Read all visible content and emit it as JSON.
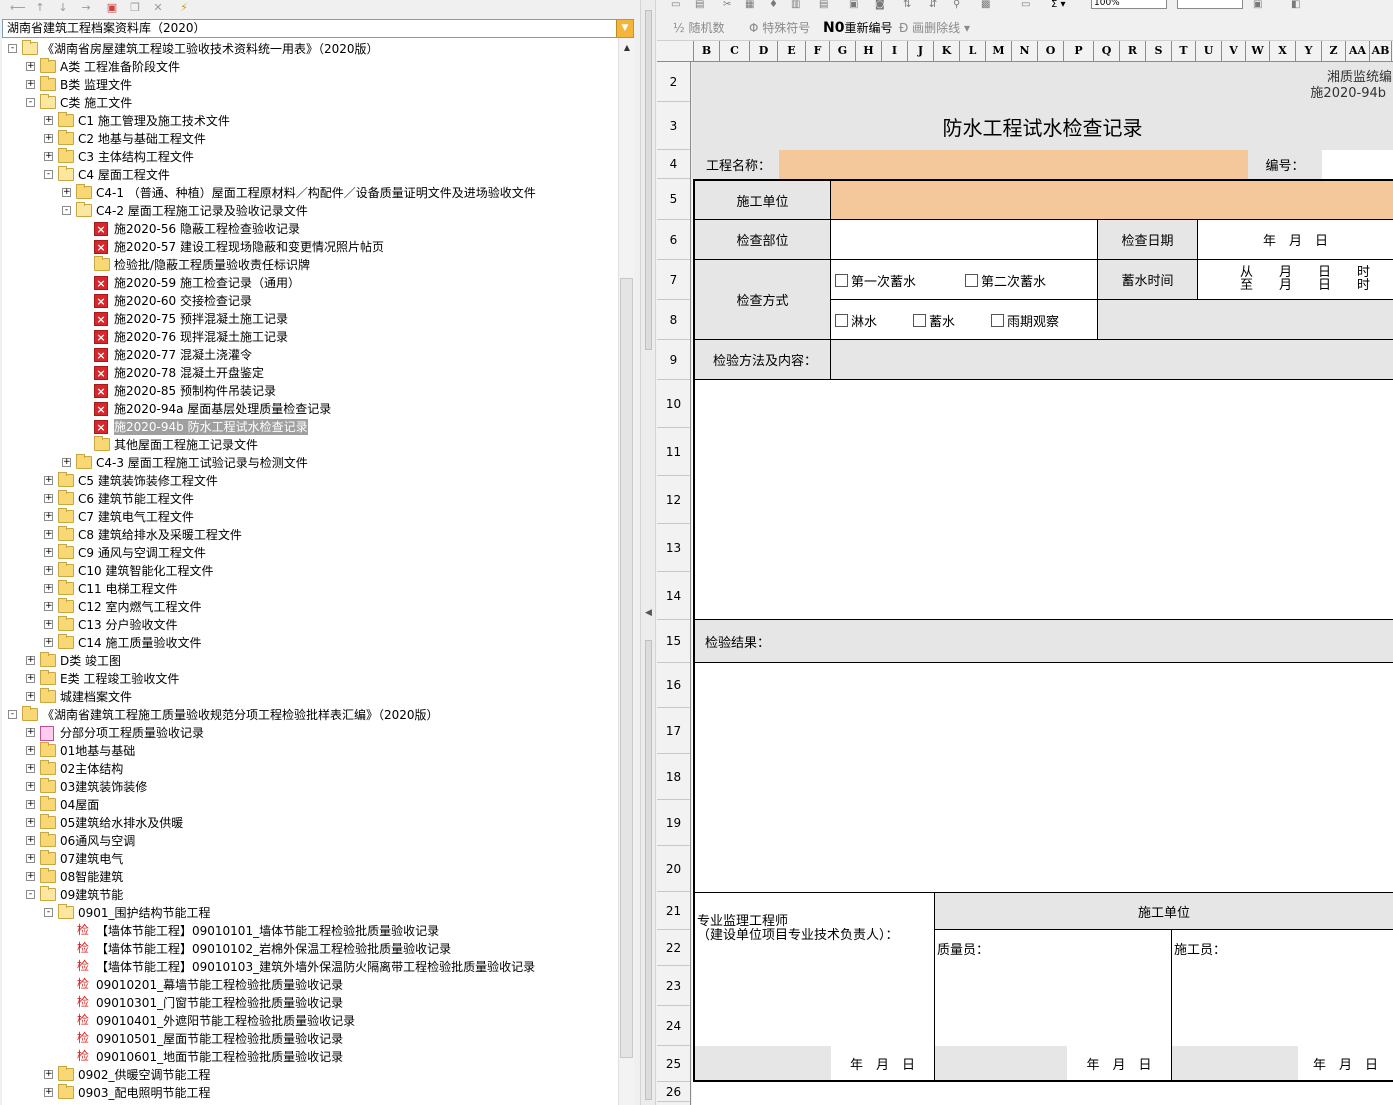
{
  "left_toolbar": {
    "icons": [
      "arrow-left-icon",
      "arrow-up-icon",
      "arrow-down-icon",
      "arrow-right-icon",
      "new-doc-icon",
      "copy-icon",
      "delete-icon",
      "flash-icon"
    ]
  },
  "combo": {
    "value": "湖南省建筑工程档案资料库（2020）"
  },
  "tree": [
    {
      "level": 0,
      "exp": "-",
      "icon": "folder-open",
      "label": "《湖南省房屋建筑工程竣工验收技术资料统一用表》（2020版）"
    },
    {
      "level": 1,
      "exp": "+",
      "icon": "folder",
      "label": "A类 工程准备阶段文件"
    },
    {
      "level": 1,
      "exp": "+",
      "icon": "folder",
      "label": "B类 监理文件"
    },
    {
      "level": 1,
      "exp": "-",
      "icon": "folder-open",
      "label": "C类 施工文件"
    },
    {
      "level": 2,
      "exp": "+",
      "icon": "folder",
      "label": "C1 施工管理及施工技术文件"
    },
    {
      "level": 2,
      "exp": "+",
      "icon": "folder",
      "label": "C2 地基与基础工程文件"
    },
    {
      "level": 2,
      "exp": "+",
      "icon": "folder",
      "label": "C3 主体结构工程文件"
    },
    {
      "level": 2,
      "exp": "-",
      "icon": "folder-open",
      "label": "C4 屋面工程文件"
    },
    {
      "level": 3,
      "exp": "+",
      "icon": "folder",
      "label": "C4-1 （普通、种植）屋面工程原材料／构配件／设备质量证明文件及进场验收文件"
    },
    {
      "level": 3,
      "exp": "-",
      "icon": "folder-open",
      "label": "C4-2 屋面工程施工记录及验收记录文件"
    },
    {
      "level": 4,
      "exp": "",
      "icon": "redx",
      "label": "施2020-56 隐蔽工程检查验收记录"
    },
    {
      "level": 4,
      "exp": "",
      "icon": "redx",
      "label": "施2020-57 建设工程现场隐蔽和变更情况照片帖页"
    },
    {
      "level": 4,
      "exp": "",
      "icon": "folder",
      "label": "检验批/隐蔽工程质量验收责任标识牌"
    },
    {
      "level": 4,
      "exp": "",
      "icon": "redx",
      "label": "施2020-59 施工检查记录（通用）"
    },
    {
      "level": 4,
      "exp": "",
      "icon": "redx",
      "label": "施2020-60 交接检查记录"
    },
    {
      "level": 4,
      "exp": "",
      "icon": "redx",
      "label": "施2020-75 预拌混凝土施工记录"
    },
    {
      "level": 4,
      "exp": "",
      "icon": "redx",
      "label": "施2020-76 现拌混凝土施工记录"
    },
    {
      "level": 4,
      "exp": "",
      "icon": "redx",
      "label": "施2020-77 混凝土浇灌令"
    },
    {
      "level": 4,
      "exp": "",
      "icon": "redx",
      "label": "施2020-78 混凝土开盘鉴定"
    },
    {
      "level": 4,
      "exp": "",
      "icon": "redx",
      "label": "施2020-85 预制构件吊装记录"
    },
    {
      "level": 4,
      "exp": "",
      "icon": "redx",
      "label": "施2020-94a 屋面基层处理质量检查记录"
    },
    {
      "level": 4,
      "exp": "",
      "icon": "redx",
      "label": "施2020-94b 防水工程试水检查记录",
      "selected": true
    },
    {
      "level": 4,
      "exp": "",
      "icon": "folder",
      "label": "其他屋面工程施工记录文件"
    },
    {
      "level": 3,
      "exp": "+",
      "icon": "folder",
      "label": "C4-3 屋面工程施工试验记录与检测文件"
    },
    {
      "level": 2,
      "exp": "+",
      "icon": "folder",
      "label": "C5 建筑装饰装修工程文件"
    },
    {
      "level": 2,
      "exp": "+",
      "icon": "folder",
      "label": "C6 建筑节能工程文件"
    },
    {
      "level": 2,
      "exp": "+",
      "icon": "folder",
      "label": "C7 建筑电气工程文件"
    },
    {
      "level": 2,
      "exp": "+",
      "icon": "folder",
      "label": "C8 建筑给排水及采暖工程文件"
    },
    {
      "level": 2,
      "exp": "+",
      "icon": "folder",
      "label": "C9 通风与空调工程文件"
    },
    {
      "level": 2,
      "exp": "+",
      "icon": "folder",
      "label": "C10 建筑智能化工程文件"
    },
    {
      "level": 2,
      "exp": "+",
      "icon": "folder",
      "label": "C11 电梯工程文件"
    },
    {
      "level": 2,
      "exp": "+",
      "icon": "folder",
      "label": "C12 室内燃气工程文件"
    },
    {
      "level": 2,
      "exp": "+",
      "icon": "folder",
      "label": "C13 分户验收文件"
    },
    {
      "level": 2,
      "exp": "+",
      "icon": "folder",
      "label": "C14 施工质量验收文件"
    },
    {
      "level": 1,
      "exp": "+",
      "icon": "folder",
      "label": "D类 竣工图"
    },
    {
      "level": 1,
      "exp": "+",
      "icon": "folder",
      "label": "E类 工程竣工验收文件"
    },
    {
      "level": 1,
      "exp": "+",
      "icon": "folder",
      "label": "城建档案文件"
    },
    {
      "level": 0,
      "exp": "-",
      "icon": "folder",
      "label": "《湖南省建筑工程施工质量验收规范分项工程检验批样表汇编》（2020版）"
    },
    {
      "level": 1,
      "exp": "+",
      "icon": "doc",
      "label": "分部分项工程质量验收记录"
    },
    {
      "level": 1,
      "exp": "+",
      "icon": "folder",
      "label": "01地基与基础"
    },
    {
      "level": 1,
      "exp": "+",
      "icon": "folder",
      "label": "02主体结构"
    },
    {
      "level": 1,
      "exp": "+",
      "icon": "folder",
      "label": "03建筑装饰装修"
    },
    {
      "level": 1,
      "exp": "+",
      "icon": "folder",
      "label": "04屋面"
    },
    {
      "level": 1,
      "exp": "+",
      "icon": "folder",
      "label": "05建筑给水排水及供暖"
    },
    {
      "level": 1,
      "exp": "+",
      "icon": "folder",
      "label": "06通风与空调"
    },
    {
      "level": 1,
      "exp": "+",
      "icon": "folder",
      "label": "07建筑电气"
    },
    {
      "level": 1,
      "exp": "+",
      "icon": "folder",
      "label": "08智能建筑"
    },
    {
      "level": 1,
      "exp": "-",
      "icon": "folder-open",
      "label": "09建筑节能"
    },
    {
      "level": 2,
      "exp": "-",
      "icon": "folder-open",
      "label": "0901_围护结构节能工程"
    },
    {
      "level": 3,
      "exp": "",
      "icon": "jian",
      "label": "【墙体节能工程】09010101_墙体节能工程检验批质量验收记录"
    },
    {
      "level": 3,
      "exp": "",
      "icon": "jian",
      "label": "【墙体节能工程】09010102_岩棉外保温工程检验批质量验收记录"
    },
    {
      "level": 3,
      "exp": "",
      "icon": "jian",
      "label": "【墙体节能工程】09010103_建筑外墙外保温防火隔离带工程检验批质量验收记录"
    },
    {
      "level": 3,
      "exp": "",
      "icon": "jian",
      "label": "09010201_幕墙节能工程检验批质量验收记录"
    },
    {
      "level": 3,
      "exp": "",
      "icon": "jian",
      "label": "09010301_门窗节能工程检验批质量验收记录"
    },
    {
      "level": 3,
      "exp": "",
      "icon": "jian",
      "label": "09010401_外遮阳节能工程检验批质量验收记录"
    },
    {
      "level": 3,
      "exp": "",
      "icon": "jian",
      "label": "09010501_屋面节能工程检验批质量验收记录"
    },
    {
      "level": 3,
      "exp": "",
      "icon": "jian",
      "label": "09010601_地面节能工程检验批质量验收记录"
    },
    {
      "level": 2,
      "exp": "+",
      "icon": "folder",
      "label": "0902_供暖空调节能工程"
    },
    {
      "level": 2,
      "exp": "+",
      "icon": "folder",
      "label": "0903_配电照明节能工程"
    }
  ],
  "jian_glyph": "检",
  "right_toolbar": {
    "zoom": "100%",
    "btn_random": "随机数",
    "btn_special": "特殊符号",
    "btn_renumber": "重新编号",
    "btn_strike": "画删除线"
  },
  "columns": [
    "B",
    "C",
    "D",
    "E",
    "F",
    "G",
    "H",
    "I",
    "J",
    "K",
    "L",
    "M",
    "N",
    "O",
    "P",
    "Q",
    "R",
    "S",
    "T",
    "U",
    "V",
    "W",
    "X",
    "Y",
    "Z",
    "AA",
    "AB"
  ],
  "rows": [
    "2",
    "3",
    "4",
    "5",
    "6",
    "7",
    "8",
    "9",
    "10",
    "11",
    "12",
    "13",
    "14",
    "15",
    "16",
    "17",
    "18",
    "19",
    "20",
    "21",
    "22",
    "23",
    "24",
    "25",
    "26"
  ],
  "form": {
    "code_line1": "湘质监统编",
    "code_line2": "施2020-94b",
    "title": "防水工程试水检查记录",
    "project_name_label": "工程名称：",
    "number_label": "编号：",
    "construction_unit_label": "施工单位",
    "check_part_label": "检查部位",
    "check_date_label": "检查日期",
    "check_date_value": "年　月　日",
    "check_method_label": "检查方式",
    "cb_first": "第一次蓄水",
    "cb_second": "第二次蓄水",
    "storage_time_label": "蓄水时间",
    "time_from": "从　　月　　日　　时",
    "time_to": "至　　月　　日　　时",
    "cb_spray": "淋水",
    "cb_store": "蓄水",
    "cb_rain": "雨期观察",
    "method_content_label": "检验方法及内容：",
    "result_label": "检验结果：",
    "supervisor_line1": "专业监理工程师",
    "supervisor_line2": "（建设单位项目专业技术负责人）：",
    "contractor_label": "施工单位",
    "quality_label": "质量员：",
    "worker_label": "施工员：",
    "date_ymd": "年　月　日"
  }
}
